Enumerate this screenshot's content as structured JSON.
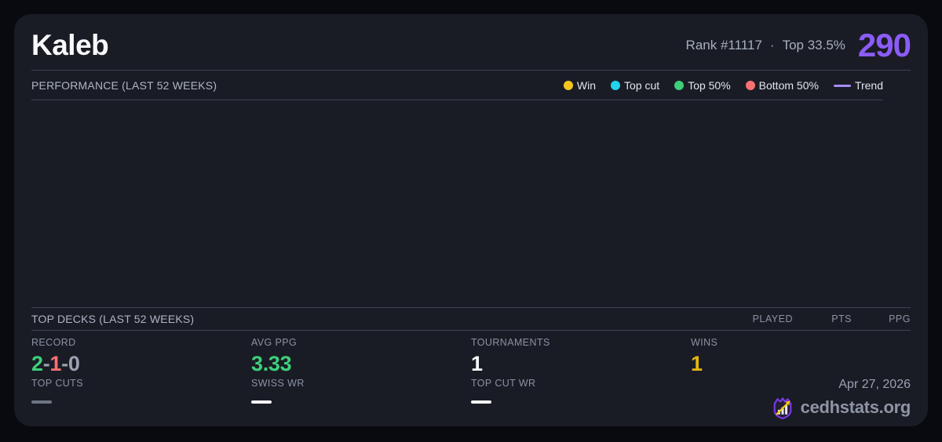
{
  "colors": {
    "accent_purple": "#8b5cf6",
    "trend_purple": "#a78bfa",
    "win_yellow": "#f2c61d",
    "wins_gold": "#e7b70d",
    "top_cut_cyan": "#22d3ee",
    "green": "#3ecf7a",
    "red": "#f87171",
    "neutral_gray": "#9aa1b2",
    "dash_gray": "#6f7585",
    "white": "#f5f6f8"
  },
  "header": {
    "player_name": "Kaleb",
    "rank": "Rank #11117",
    "separator": "·",
    "top_percent": "Top 33.5%",
    "score": "290"
  },
  "performance": {
    "section_title": "PERFORMANCE (LAST 52 WEEKS)",
    "legend": [
      {
        "label": "Win",
        "color": "#f2c61d",
        "swatch": "dot"
      },
      {
        "label": "Top cut",
        "color": "#22d3ee",
        "swatch": "dot"
      },
      {
        "label": "Top 50%",
        "color": "#3ecf7a",
        "swatch": "dot"
      },
      {
        "label": "Bottom 50%",
        "color": "#f87171",
        "swatch": "dot"
      },
      {
        "label": "Trend",
        "color": "#a78bfa",
        "swatch": "line"
      }
    ],
    "chart": {
      "type": "scatter",
      "points": []
    }
  },
  "top_decks": {
    "section_title": "TOP DECKS (LAST 52 WEEKS)",
    "columns": [
      "PLAYED",
      "PTS",
      "PPG"
    ],
    "rows": []
  },
  "stats": {
    "record": {
      "label": "RECORD",
      "wins": "2",
      "losses": "1",
      "draws": "0",
      "separator": "-"
    },
    "avg_ppg": {
      "label": "AVG PPG",
      "value": "3.33"
    },
    "tournaments": {
      "label": "TOURNAMENTS",
      "value": "1"
    },
    "wins": {
      "label": "WINS",
      "value": "1"
    },
    "top_cuts": {
      "label": "TOP CUTS",
      "value": "—"
    },
    "swiss_wr": {
      "label": "SWISS WR",
      "value": "—"
    },
    "top_cut_wr": {
      "label": "TOP CUT WR",
      "value": "—"
    }
  },
  "footer": {
    "date": "Apr 27, 2026",
    "brand": "cedhstats.org"
  }
}
